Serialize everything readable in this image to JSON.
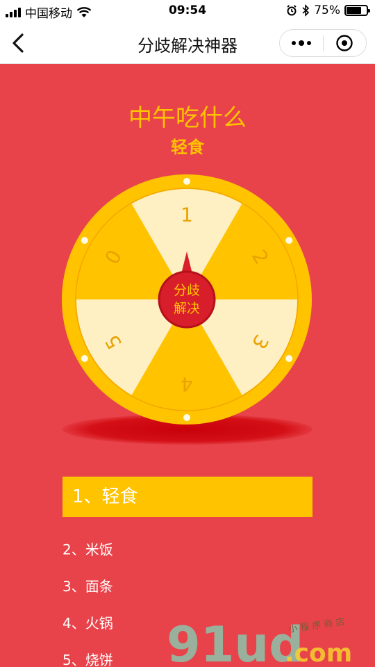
{
  "status": {
    "carrier": "中国移动",
    "time": "09:54",
    "battery_text": "75%",
    "battery_level": 0.75
  },
  "nav": {
    "title": "分歧解决神器",
    "back_icon": "chevron-left-icon",
    "more_icon": "more-dots-icon",
    "close_icon": "target-close-icon"
  },
  "question": "中午吃什么",
  "result": "轻食",
  "wheel": {
    "center_line1": "分歧",
    "center_line2": "解决",
    "segments": [
      "1",
      "2",
      "3",
      "4",
      "5",
      "0"
    ]
  },
  "options": {
    "selected": "1、轻食",
    "items": [
      "2、米饭",
      "3、面条",
      "4、火锅",
      "5、烧饼"
    ]
  },
  "watermark": {
    "brand": "91ud",
    "suffix": ".com",
    "tagline": "小 程 序 商 店"
  },
  "colors": {
    "background": "#e8434a",
    "accent_yellow": "#ffc300",
    "segment_light": "#fff0c4",
    "center_red": "#d81e2a"
  }
}
